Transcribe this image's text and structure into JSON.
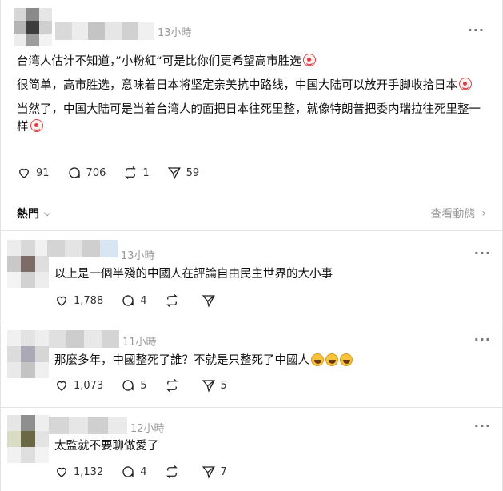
{
  "post": {
    "time": "13小時",
    "paragraph_1": "台湾人估计不知道，”小粉紅“可是比你们更希望高市胜选",
    "paragraph_2": "很简单，高市胜选，意味着日本将坚定亲美抗中路线，中国大陆可以放开手脚收拾日本",
    "paragraph_3": "当然了，中国大陆可是当着台湾人的面把日本往死里整，就像特朗普把委内瑞拉往死里整一样",
    "likes": "91",
    "replies": "706",
    "reposts": "1",
    "shares": "59"
  },
  "sort": {
    "label": "熱門",
    "view_activity": "查看動態"
  },
  "comments": [
    {
      "time": "13小時",
      "text": "以上是一個半殘的中國人在評論自由民主世界的大小事",
      "likes": "1,788",
      "replies": "4",
      "reposts": "",
      "shares": ""
    },
    {
      "time": "11小時",
      "text": "那麼多年，中國整死了誰？不就是只整死了中國人",
      "likes": "1,073",
      "replies": "5",
      "reposts": "",
      "shares": "5"
    },
    {
      "time": "12小時",
      "text": "太監就不要聊做愛了",
      "likes": "1,132",
      "replies": "4",
      "reposts": "",
      "shares": "7"
    }
  ],
  "icons": {
    "like": "heart-icon",
    "reply": "comment-icon",
    "repost": "repost-icon",
    "share": "send-icon",
    "more": "more-dots-icon"
  }
}
